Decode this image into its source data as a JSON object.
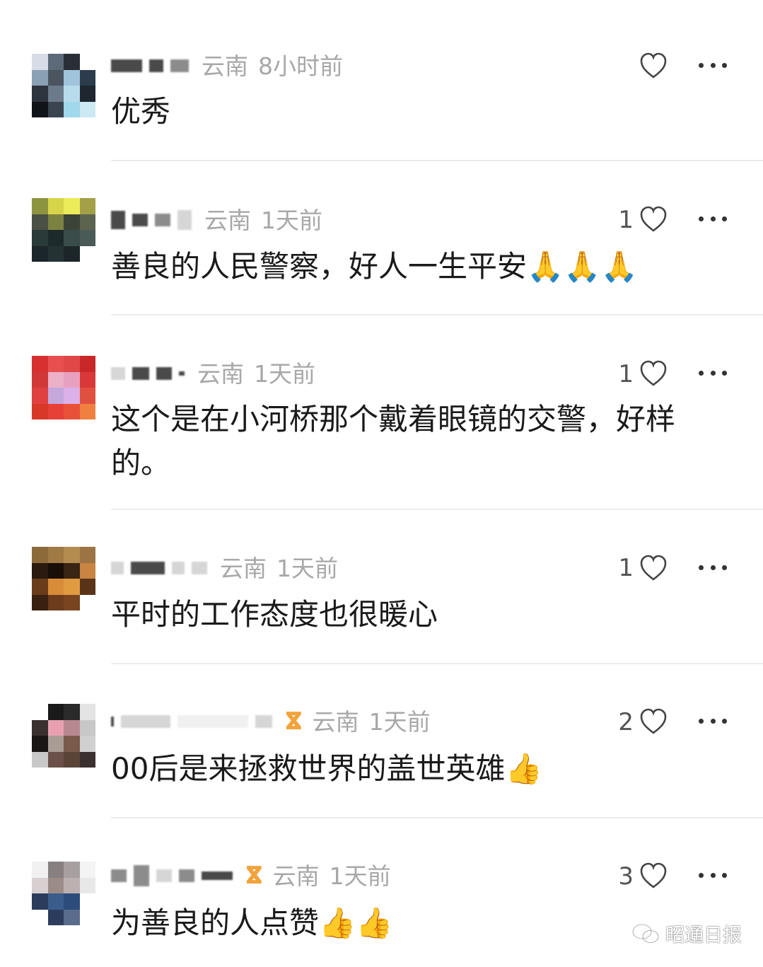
{
  "comments": [
    {
      "location": "云南",
      "time": "8小时前",
      "likes": "",
      "text": "优秀",
      "badge": ""
    },
    {
      "location": "云南",
      "time": "1天前",
      "likes": "1",
      "text": "善良的人民警察，好人一生平安🙏🙏🙏",
      "badge": ""
    },
    {
      "location": "云南",
      "time": "1天前",
      "likes": "1",
      "text": "这个是在小河桥那个戴着眼镜的交警，好样的。",
      "badge": ""
    },
    {
      "location": "云南",
      "time": "1天前",
      "likes": "1",
      "text": "平时的工作态度也很暖心",
      "badge": ""
    },
    {
      "location": "云南",
      "time": "1天前",
      "likes": "2",
      "text": "00后是来拯救世界的盖世英雄👍",
      "badge": "ⴵ"
    },
    {
      "location": "云南",
      "time": "1天前",
      "likes": "3",
      "text": "为善良的人点赞👍👍",
      "badge": "ⴵ"
    }
  ],
  "icons": {
    "like": "heart-outline-icon",
    "more": "more-dots-icon",
    "watermark": "wechat-icon"
  },
  "watermark": {
    "label": "昭通日报"
  },
  "colors": {
    "meta_text": "#a8a8a8",
    "badge": "#f2a33c",
    "divider": "#ececec"
  }
}
